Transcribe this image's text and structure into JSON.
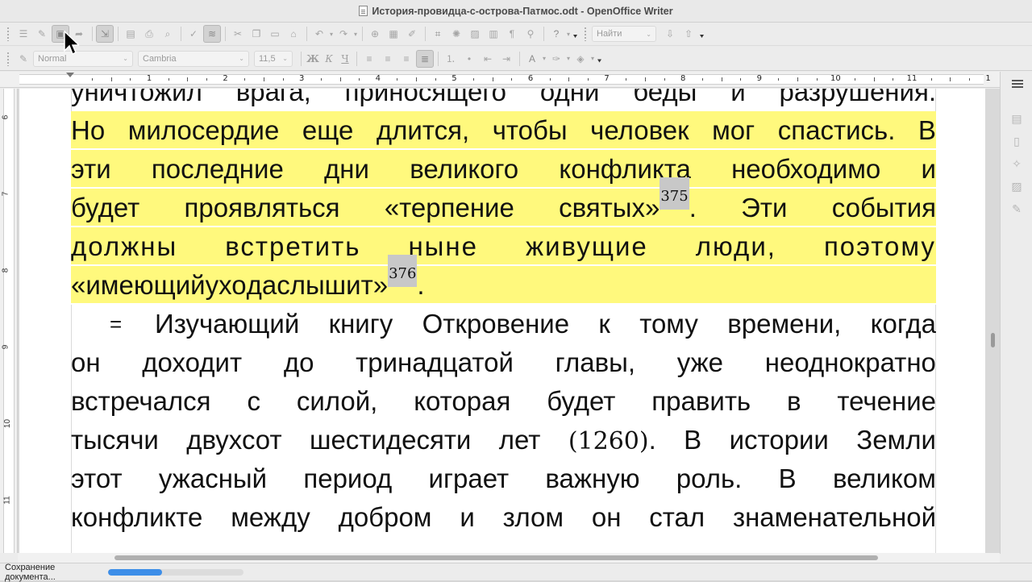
{
  "window": {
    "title": "История-провидца-с-острова-Патмос.odt - OpenOffice Writer"
  },
  "toolbar_standard": {
    "buttons": [
      "navigator-toggle",
      "edit-file",
      "save",
      "export",
      "export-pdf",
      "print",
      "print-preview",
      "spellcheck",
      "autospellcheck",
      "cut",
      "copy",
      "paste",
      "format-paintbrush",
      "undo",
      "redo",
      "hyperlink",
      "table",
      "show-draw",
      "find",
      "gallery",
      "datasources",
      "nonprinting",
      "zoom",
      "help"
    ],
    "search_combo_value": "Найти"
  },
  "toolbar_format": {
    "style_value": "Normal",
    "font_value": "Cambria",
    "size_value": "11,5",
    "bold_label": "Ж",
    "italic_label": "К",
    "underline_label": "Ч"
  },
  "ruler": {
    "numbers": [
      "1",
      "2",
      "3",
      "4",
      "5",
      "6",
      "7",
      "8",
      "9",
      "10",
      "11",
      "1"
    ],
    "vertical_numbers": [
      "6",
      "7",
      "8",
      "9",
      "10",
      "11"
    ]
  },
  "document": {
    "lines": [
      {
        "text": "уничтожил врага, приносящего одни беды и разрушения.",
        "highlight": false
      },
      {
        "text": "Но милосердие еще длится, чтобы человек мог спастись. В",
        "highlight": true
      },
      {
        "text": "эти последние дни великого конфликта необходимо и",
        "highlight": true
      },
      {
        "text_before": "будет проявляться «терпение святых»",
        "footnote": "375",
        "text_after": ". Эти события",
        "highlight": true
      },
      {
        "text": "должны встретить ныне живущие люди, поэтому",
        "highlight": true,
        "wide": true
      },
      {
        "text_before": "«имеющий ухо да слышит»",
        "footnote": "376",
        "text_after": ".",
        "highlight": true,
        "last": true
      },
      {
        "marker": "=",
        "text": "Изучающий книгу Откровение к тому времени, когда",
        "highlight": false
      },
      {
        "text": "он доходит до тринадцатой главы, уже неоднократно",
        "highlight": false
      },
      {
        "text": "встречался с силой, которая будет править в течение",
        "highlight": false
      },
      {
        "text_before": "тысячи двухсот шестидесяти лет ",
        "serif_number": "(1260)",
        "text_after": ". В истории Земли",
        "highlight": false
      },
      {
        "text": "этот ужасный период играет важную роль. В великом",
        "highlight": false
      },
      {
        "text": "конфликте между добром и злом он стал знаменательной",
        "highlight": false
      }
    ]
  },
  "statusbar": {
    "text": "Сохранение документа...",
    "progress": 0.4
  },
  "colors": {
    "highlight": "#fff97d",
    "progress": "#3d8ee8"
  }
}
